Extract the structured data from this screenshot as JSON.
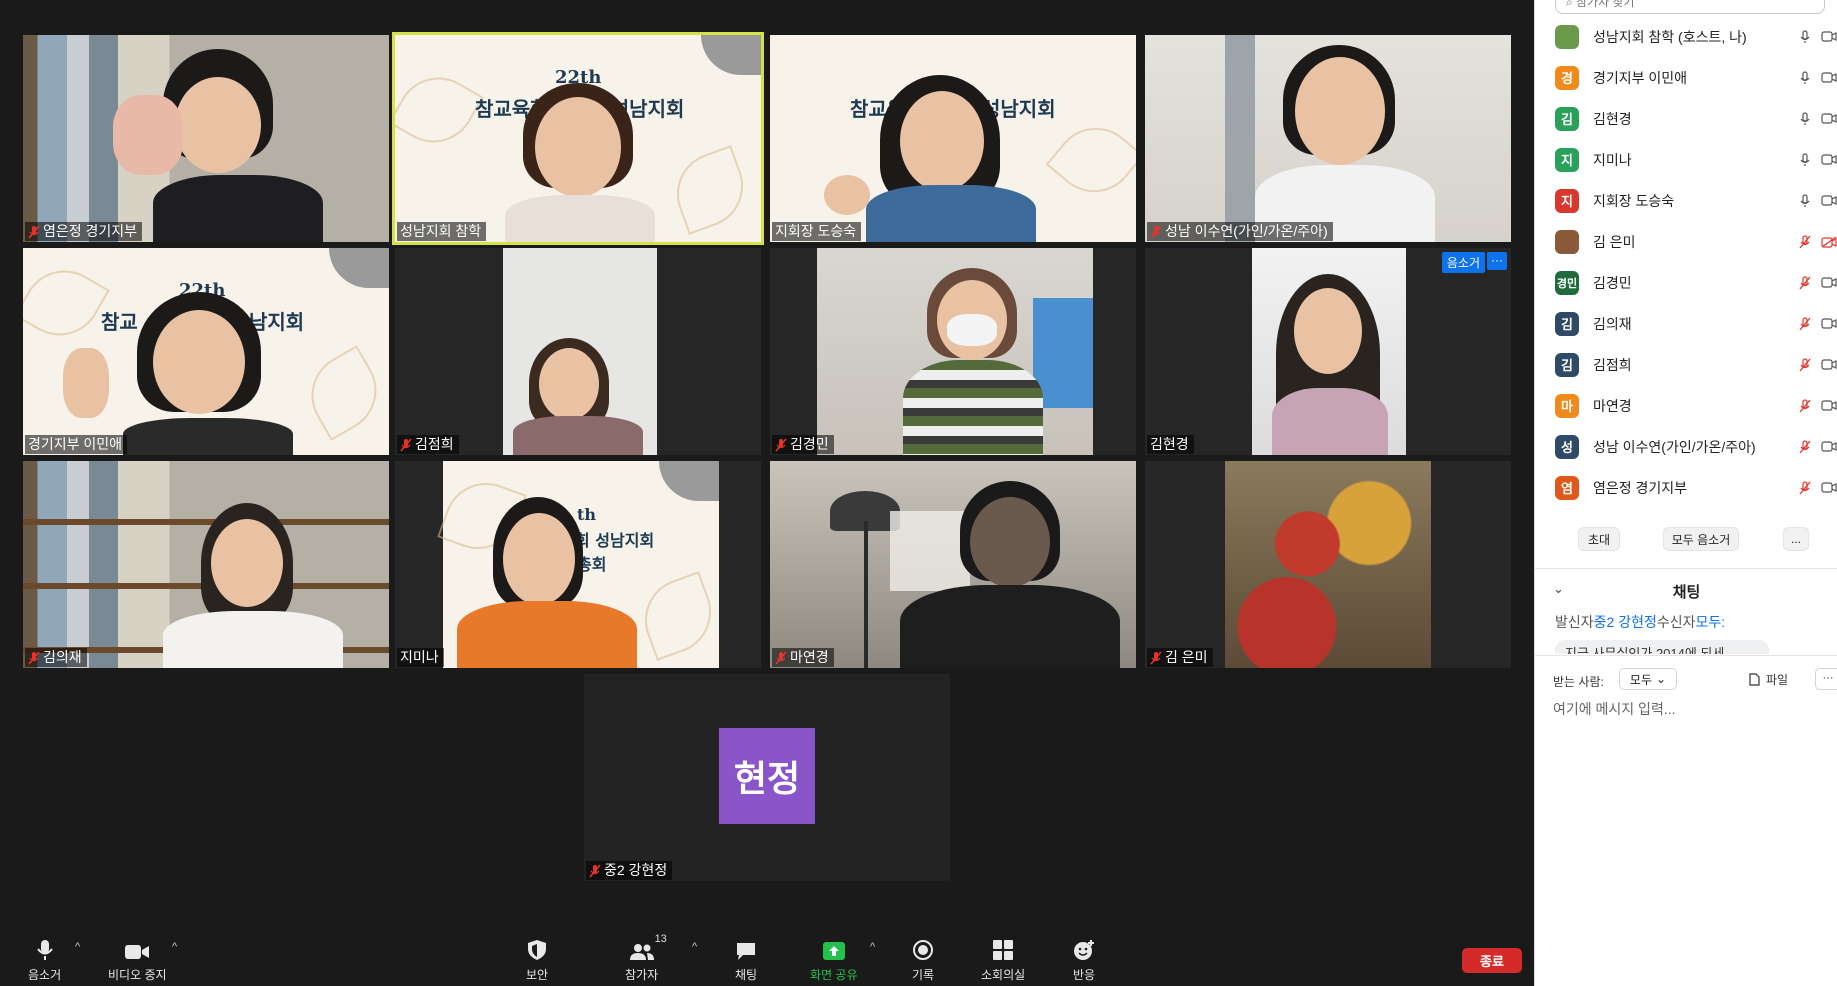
{
  "tiles": [
    {
      "name": "염은정 경기지부",
      "muted": true
    },
    {
      "name": "성남지회 참학",
      "muted": false
    },
    {
      "name": "지회장 도승숙",
      "muted": false
    },
    {
      "name": "성남 이수연(가인/가온/주아)",
      "muted": true
    },
    {
      "name": "경기지부 이민애",
      "muted": false
    },
    {
      "name": "김점희",
      "muted": true
    },
    {
      "name": "김경민",
      "muted": true
    },
    {
      "name": "김현경",
      "muted": false
    },
    {
      "name": "김의재",
      "muted": true
    },
    {
      "name": "지미나",
      "muted": false
    },
    {
      "name": "마연경",
      "muted": true
    },
    {
      "name": "김 은미",
      "muted": true
    },
    {
      "name": "중2 강현정",
      "muted": true
    }
  ],
  "slide_text": {
    "line1": "22th",
    "line2": "참교육학부모회 성남지회",
    "line_short": "성남지회",
    "line_partial_a": "참교",
    "line_partial_b": "남지회",
    "line_partial_c": "참교육",
    "th": "th",
    "line_r1": "회 성남지회",
    "line_r2": "총회"
  },
  "avatar_self": "현정",
  "tile_badges": {
    "mute": "음소거",
    "more": "···"
  },
  "toolbar": {
    "mute": "음소거",
    "video": "비디오 중지",
    "security": "보안",
    "participants": "참가자",
    "participants_count": "13",
    "chat": "채팅",
    "share": "화면 공유",
    "record": "기록",
    "breakout": "소회의실",
    "reactions": "반응",
    "end": "종료"
  },
  "panel": {
    "search_placeholder": "참가자 찾기",
    "participants": [
      {
        "avatar": "",
        "color": "#6a9a4a",
        "name": "성남지회 참학 (호스트, 나)",
        "mic": "on",
        "cam": "on"
      },
      {
        "avatar": "경",
        "color": "#f08a1c",
        "name": "경기지부 이민애",
        "mic": "on",
        "cam": "on"
      },
      {
        "avatar": "김",
        "color": "#2aa05a",
        "name": "김현경",
        "mic": "on",
        "cam": "on"
      },
      {
        "avatar": "지",
        "color": "#2aa05a",
        "name": "지미나",
        "mic": "on",
        "cam": "on"
      },
      {
        "avatar": "지",
        "color": "#d9382c",
        "name": "지회장 도승숙",
        "mic": "on",
        "cam": "on"
      },
      {
        "avatar": "",
        "color": "#8a5a3a",
        "name": "김 은미",
        "mic": "off",
        "cam": "off"
      },
      {
        "avatar": "경민",
        "color": "#1f6b3c",
        "name": "김경민",
        "mic": "off",
        "cam": "on"
      },
      {
        "avatar": "김",
        "color": "#2e4a66",
        "name": "김의재",
        "mic": "off",
        "cam": "on"
      },
      {
        "avatar": "김",
        "color": "#2e4a66",
        "name": "김점희",
        "mic": "off",
        "cam": "on"
      },
      {
        "avatar": "마",
        "color": "#f08a1c",
        "name": "마연경",
        "mic": "off",
        "cam": "on"
      },
      {
        "avatar": "성",
        "color": "#2e4a66",
        "name": "성남 이수연(가인/가온/주아)",
        "mic": "off",
        "cam": "on"
      },
      {
        "avatar": "염",
        "color": "#e0591c",
        "name": "염은정 경기지부",
        "mic": "off",
        "cam": "on"
      }
    ],
    "invite": "초대",
    "mute_all": "모두 음소거",
    "more": "...",
    "chat_title": "채팅",
    "chat_sender_prefix": "발신자",
    "chat_sender": "중2 강현정",
    "chat_receiver_prefix": "수신자",
    "chat_receiver": "모두:",
    "chat_message": "지금 사무실인가 2014에 되세",
    "to_label": "받는 사람:",
    "to_value": "모두",
    "file": "파일",
    "compose_more": "···",
    "input_placeholder": "여기에 메시지 입력..."
  }
}
